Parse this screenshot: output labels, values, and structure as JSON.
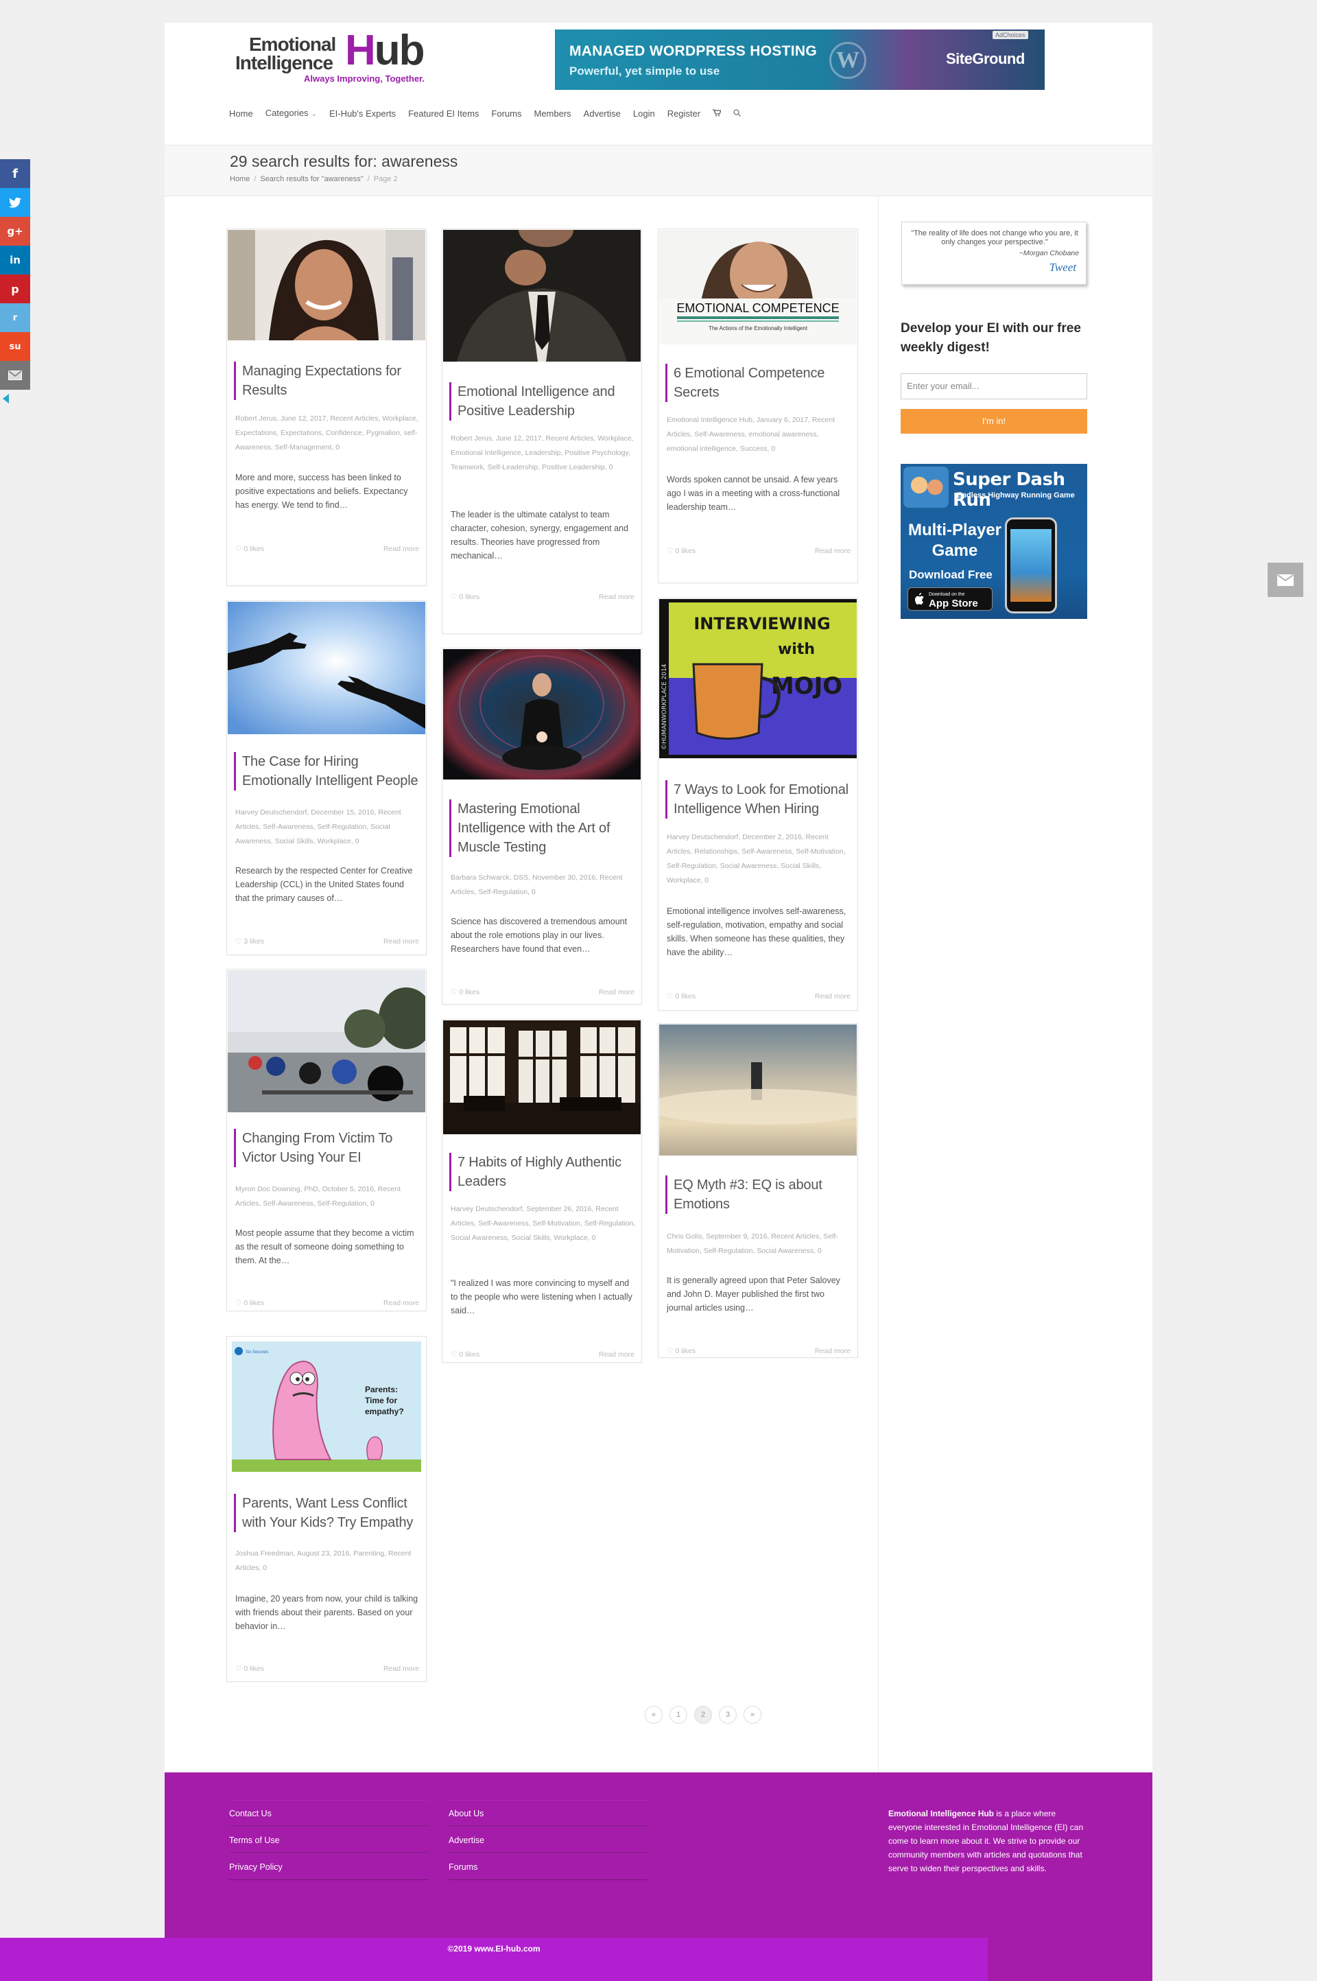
{
  "site": {
    "logo_line1": "Emotional",
    "logo_line2": "Intelligence",
    "logo_hub_h": "H",
    "logo_hub_rest": "ub",
    "logo_tagline": "Always Improving, Together."
  },
  "banner_ad": {
    "headline": "MANAGED WORDPRESS HOSTING",
    "subline": "Powerful, yet simple to use",
    "brand": "SiteGround",
    "ad_choices": "AdChoices",
    "wordpress_glyph": "W"
  },
  "nav": {
    "items": [
      "Home",
      "Categories",
      "EI-Hub's Experts",
      "Featured EI Items",
      "Forums",
      "Members",
      "Advertise",
      "Login",
      "Register"
    ],
    "cart_icon": "cart-icon",
    "search_icon": "search-icon"
  },
  "page": {
    "title": "29 search results for: awareness",
    "breadcrumb": [
      "Home",
      "Search results for \"awareness\"",
      "Page 2"
    ]
  },
  "posts": [
    {
      "title": "Managing Expectations for Results",
      "meta": "Robert Jerus, June 12, 2017, Recent Articles, Workplace, Expectations, Expectations, Confidence, Pygmalion, self-Awareness, Self-Management, 0",
      "excerpt": "More and more, success has been linked to positive expectations and beliefs. Expectancy has energy. We tend to find…",
      "likes": "0 likes",
      "read_more": "Read more"
    },
    {
      "title": "Emotional Intelligence and Positive Leadership",
      "meta": "Robert Jerus, June 12, 2017, Recent Articles, Workplace, Emotional Intelligence, Leadership, Positive Psychology, Teamwork, Self-Leadership, Positive Leadership, 0",
      "excerpt": "The leader is the ultimate catalyst to team character, cohesion, synergy, engagement and results. Theories have progressed from mechanical…",
      "likes": "0 likes",
      "read_more": "Read more"
    },
    {
      "title": "6 Emotional Competence Secrets",
      "meta": "Emotional Intelligence Hub, January 6, 2017, Recent Articles, Self-Awareness, emotional awareness, emotional intelligence, Success, 0",
      "excerpt": "Words spoken cannot be unsaid. A few years ago I was in a meeting with a cross-functional leadership team…",
      "likes": "0 likes",
      "read_more": "Read more",
      "img_caption": "EMOTIONAL COMPETENCE",
      "img_sub": "The Actions of the Emotionally Intelligent"
    },
    {
      "title": "The Case for Hiring Emotionally Intelligent People",
      "meta": "Harvey Deutschendorf, December 15, 2016, Recent Articles, Self-Awareness, Self-Regulation, Social Awareness, Social Skills, Workplace, 0",
      "excerpt": "Research by the respected Center for Creative Leadership (CCL) in the United States found that the primary causes of…",
      "likes": "3 likes",
      "read_more": "Read more"
    },
    {
      "title": "Mastering Emotional Intelligence with the Art of Muscle Testing",
      "meta": "Barbara Schwarck, DSS, November 30, 2016, Recent Articles, Self-Regulation, 0",
      "excerpt": "Science has discovered a tremendous amount about the role emotions play in our lives. Researchers have found that even…",
      "likes": "0 likes",
      "read_more": "Read more"
    },
    {
      "title": "7 Ways to Look for Emotional Intelligence When Hiring",
      "meta": "Harvey Deutschendorf, December 2, 2016, Recent Articles, Relationships, Self-Awareness, Self-Motivation, Self-Regulation, Social Awareness, Social Skills, Workplace, 0",
      "excerpt": "Emotional intelligence involves self-awareness, self-regulation, motivation, empathy and social skills. When someone has these qualities, they have the ability…",
      "likes": "0 likes",
      "read_more": "Read more",
      "img_text_1": "INTERVIEWING",
      "img_text_2": "with",
      "img_text_3": "MOJO",
      "img_side": "©HUMANWORKPLACE 2014"
    },
    {
      "title": "Changing From Victim To Victor Using Your EI",
      "meta": "Myron Doc Downing, PhD, October 5, 2016, Recent Articles, Self-Awareness, Self-Regulation, 0",
      "excerpt": "Most people assume that they become a victim as the result of someone doing something to them. At the…",
      "likes": "0 likes",
      "read_more": "Read more"
    },
    {
      "title": "7 Habits of Highly Authentic Leaders",
      "meta": "Harvey Deutschendorf, September 26, 2016, Recent Articles, Self-Awareness, Self-Motivation, Self-Regulation, Social Awareness, Social Skills, Workplace, 0",
      "excerpt": "\"I realized I was more convincing to myself and to the people who were listening when I actually said…",
      "likes": "0 likes",
      "read_more": "Read more"
    },
    {
      "title": "EQ Myth #3: EQ is about Emotions",
      "meta": "Chris Golis, September 9, 2016, Recent Articles, Self-Motivation, Self-Regulation, Social Awareness, 0",
      "excerpt": "It is generally agreed upon that Peter Salovey and John D. Mayer published the first two journal articles using…",
      "likes": "0 likes",
      "read_more": "Read more"
    },
    {
      "title": "Parents, Want Less Conflict with Your Kids? Try Empathy",
      "meta": "Joshua Freedman, August 23, 2016, Parenting, Recent Articles, 0",
      "excerpt": "Imagine, 20 years from now, your child is talking with friends about their parents. Based on your behavior in…",
      "likes": "0 likes",
      "read_more": "Read more",
      "img_text_1": "Parents:",
      "img_text_2": "Time for",
      "img_text_3": "empathy?",
      "img_logo": "Six Seconds"
    }
  ],
  "sidebar": {
    "quote": "\"The reality of life does not change who you are, it only changes your perspective.\"",
    "quote_author": "~Morgan Chobane",
    "tweet": "Tweet",
    "digest_title": "Develop your EI with our free weekly digest!",
    "email_placeholder": "Enter your email...",
    "submit": "I'm in!",
    "game_ad": {
      "title": "Super Dash Run",
      "subtitle": "Endless Highway Running Game",
      "line1": "Multi-Player",
      "line2": "Game",
      "cta": "Download Free",
      "store_small": "Download on the",
      "store": "App Store"
    }
  },
  "pagination": [
    "«",
    "1",
    "2",
    "3",
    "»"
  ],
  "footer": {
    "col1": [
      "Contact Us",
      "Terms of Use",
      "Privacy Policy"
    ],
    "col2": [
      "About Us",
      "Advertise",
      "Forums"
    ],
    "about_bold": "Emotional Intelligence Hub",
    "about_text": " is a place where everyone interested in Emotional Intelligence (EI) can come to learn more about it. We strive to provide our community members with articles and quotations that serve to widen their perspectives and skills.",
    "copyright": "©2019 www.EI-hub.com"
  },
  "social_share": [
    "f",
    "t",
    "g+",
    "in",
    "p",
    "r",
    "su",
    "mail"
  ],
  "colors": {
    "brand_purple": "#9b1fa8",
    "footer": "#a41ca9",
    "copyright_bar": "#b21fd0",
    "cta_orange": "#f79a3a",
    "facebook": "#3b5998",
    "twitter": "#1da1f2",
    "googleplus": "#dd4b39",
    "linkedin": "#0077b5",
    "pinterest": "#cb2027",
    "reddit": "#5fb0e0",
    "stumbleupon": "#eb4924",
    "email": "#777777"
  }
}
